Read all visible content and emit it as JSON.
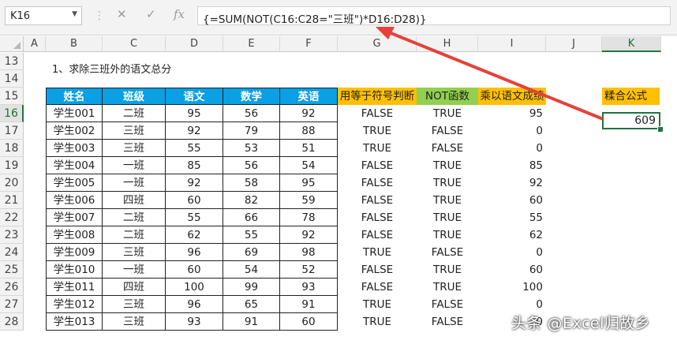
{
  "name_box": "K16",
  "formula": "{=SUM(NOT(C16:C28=\"三班\")*D16:D28)}",
  "formula_icons": [
    "cancel-icon",
    "confirm-icon",
    "function-icon"
  ],
  "columns": [
    "A",
    "B",
    "C",
    "D",
    "E",
    "F",
    "G",
    "H",
    "I",
    "J",
    "K"
  ],
  "selected_column": "K",
  "rows": [
    "13",
    "14",
    "15",
    "16",
    "17",
    "18",
    "19",
    "20",
    "21",
    "22",
    "23",
    "24",
    "25",
    "26",
    "27",
    "28"
  ],
  "selected_row": "16",
  "title": "1、求除三班外的语文总分",
  "headers": {
    "name": "姓名",
    "class": "班级",
    "chinese": "语文",
    "math": "数学",
    "english": "英语",
    "equals_check": "用等于符号判断",
    "not_func": "NOT函数",
    "multiply": "乘以语文成绩",
    "combined": "糅合公式"
  },
  "table": [
    [
      "学生001",
      "二班",
      "95",
      "56",
      "92",
      "FALSE",
      "TRUE",
      "95"
    ],
    [
      "学生002",
      "三班",
      "92",
      "79",
      "88",
      "TRUE",
      "FALSE",
      "0"
    ],
    [
      "学生003",
      "三班",
      "55",
      "53",
      "51",
      "TRUE",
      "FALSE",
      "0"
    ],
    [
      "学生004",
      "一班",
      "85",
      "56",
      "54",
      "FALSE",
      "TRUE",
      "85"
    ],
    [
      "学生005",
      "一班",
      "92",
      "58",
      "95",
      "FALSE",
      "TRUE",
      "92"
    ],
    [
      "学生006",
      "四班",
      "60",
      "82",
      "59",
      "FALSE",
      "TRUE",
      "60"
    ],
    [
      "学生007",
      "二班",
      "55",
      "66",
      "78",
      "FALSE",
      "TRUE",
      "55"
    ],
    [
      "学生008",
      "二班",
      "62",
      "55",
      "92",
      "FALSE",
      "TRUE",
      "62"
    ],
    [
      "学生009",
      "三班",
      "96",
      "69",
      "98",
      "TRUE",
      "FALSE",
      "0"
    ],
    [
      "学生010",
      "一班",
      "60",
      "54",
      "52",
      "FALSE",
      "TRUE",
      "60"
    ],
    [
      "学生011",
      "四班",
      "100",
      "99",
      "93",
      "FALSE",
      "TRUE",
      "100"
    ],
    [
      "学生012",
      "三班",
      "96",
      "65",
      "91",
      "TRUE",
      "FALSE",
      "0"
    ],
    [
      "学生013",
      "三班",
      "93",
      "91",
      "60",
      "TRUE",
      "FALSE",
      "0"
    ]
  ],
  "result": "609",
  "watermark": "头条 @Excel归故乡",
  "colors": {
    "header_blue": "#0b9fe3",
    "header_yellow": "#ffc000",
    "header_green": "#92d050",
    "selection": "#217346",
    "arrow": "#e8403a"
  }
}
